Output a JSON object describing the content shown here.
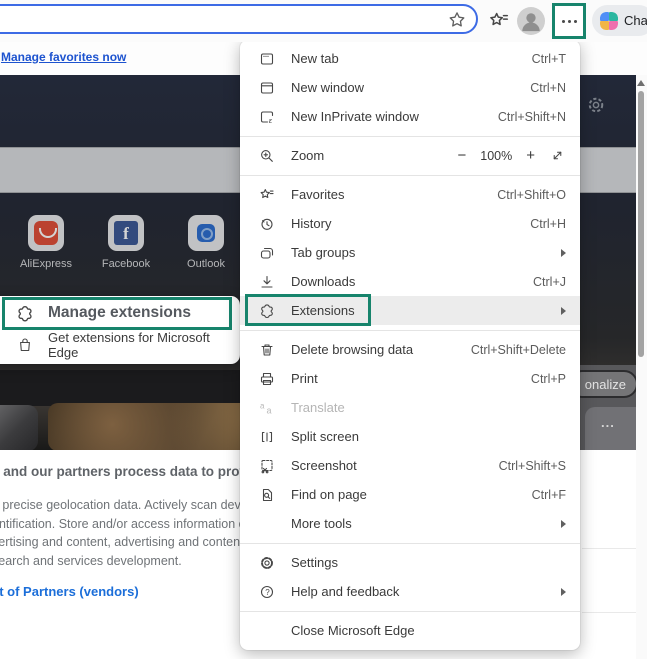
{
  "toolbar": {
    "chat_label": "Chat"
  },
  "favorites_bar": {
    "manage_link": "Manage favorites now"
  },
  "menu": {
    "items": [
      {
        "label": "New tab",
        "shortcut": "Ctrl+T"
      },
      {
        "label": "New window",
        "shortcut": "Ctrl+N"
      },
      {
        "label": "New InPrivate window",
        "shortcut": "Ctrl+Shift+N"
      },
      {
        "label": "Zoom",
        "minus": "−",
        "value": "100%",
        "plus": "+"
      },
      {
        "label": "Favorites",
        "shortcut": "Ctrl+Shift+O"
      },
      {
        "label": "History",
        "shortcut": "Ctrl+H"
      },
      {
        "label": "Tab groups"
      },
      {
        "label": "Downloads",
        "shortcut": "Ctrl+J"
      },
      {
        "label": "Extensions"
      },
      {
        "label": "Delete browsing data",
        "shortcut": "Ctrl+Shift+Delete"
      },
      {
        "label": "Print",
        "shortcut": "Ctrl+P"
      },
      {
        "label": "Translate"
      },
      {
        "label": "Split screen"
      },
      {
        "label": "Screenshot",
        "shortcut": "Ctrl+Shift+S"
      },
      {
        "label": "Find on page",
        "shortcut": "Ctrl+F"
      },
      {
        "label": "More tools"
      },
      {
        "label": "Settings"
      },
      {
        "label": "Help and feedback"
      },
      {
        "label": "Close Microsoft Edge"
      }
    ]
  },
  "submenu": {
    "manage_label": "Manage extensions",
    "get_label": "Get extensions for Microsoft Edge"
  },
  "page": {
    "tiles": [
      {
        "label": "AliExpress"
      },
      {
        "label": "Facebook"
      },
      {
        "label": "Outlook"
      }
    ],
    "consent": {
      "heading": "e and our partners process data to provi",
      "lines": [
        "e precise geolocation data. Actively scan devi",
        "entification. Store and/or access information o",
        "vertising and content, advertising and conten",
        "search and services development."
      ],
      "partners_link": "st of Partners (vendors)"
    },
    "personalize_button": "onalize",
    "card_more": "..."
  },
  "colors": {
    "annotation_green": "#17846c",
    "address_bar_blue": "#3d6be5",
    "link_blue": "#1d53cf"
  }
}
